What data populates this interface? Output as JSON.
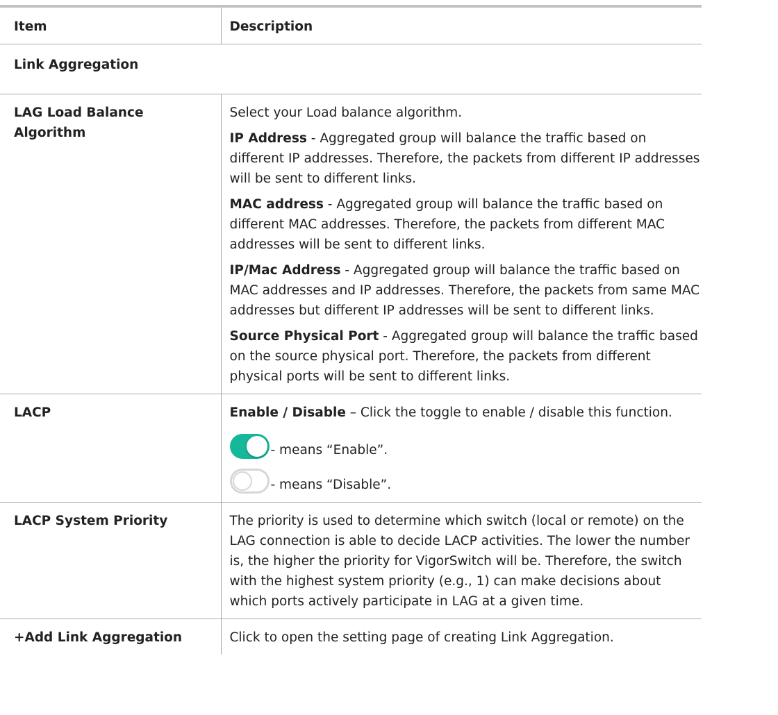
{
  "table": {
    "header": {
      "item": "Item",
      "description": "Description"
    },
    "section_title": "Link Aggregation",
    "rows": [
      {
        "item": "LAG Load Balance Algorithm",
        "intro": "Select your Load balance algorithm.",
        "options": [
          {
            "term": "IP Address",
            "text": " - Aggregated group will balance the traffic based on different IP addresses. Therefore, the packets from different IP addresses will be sent to different links."
          },
          {
            "term": "MAC address",
            "text": " - Aggregated group will balance the traffic based on different MAC addresses. Therefore, the packets from different MAC addresses will be sent to different links."
          },
          {
            "term": "IP/Mac Address",
            "text": " - Aggregated group will balance the traffic based on MAC addresses and IP addresses. Therefore, the packets from same MAC addresses but different IP addresses will be sent to different links."
          },
          {
            "term": "Source Physical Port",
            "text": " - Aggregated group will balance the traffic based on the source physical port. Therefore, the packets from different physical ports will be sent to different links."
          }
        ]
      },
      {
        "item": "LACP",
        "term": "Enable / Disable",
        "text": " – Click the toggle to enable / disable this function.",
        "toggle_on_text": "- means “Enable”.",
        "toggle_off_text": "- means “Disable”.",
        "toggle_on_color": "#16b89a",
        "toggle_off_color": "#d6d6d6"
      },
      {
        "item": "LACP System Priority",
        "text": "The priority is used to determine which switch (local or remote) on the LAG connection is able to decide LACP activities. The lower the number is, the higher the priority for VigorSwitch will be. Therefore, the switch with the highest system priority (e.g., 1) can make decisions about which ports actively participate in LAG at a given time."
      },
      {
        "item": "+Add Link Aggregation",
        "text": "Click to open the setting page of creating Link Aggregation."
      }
    ]
  }
}
